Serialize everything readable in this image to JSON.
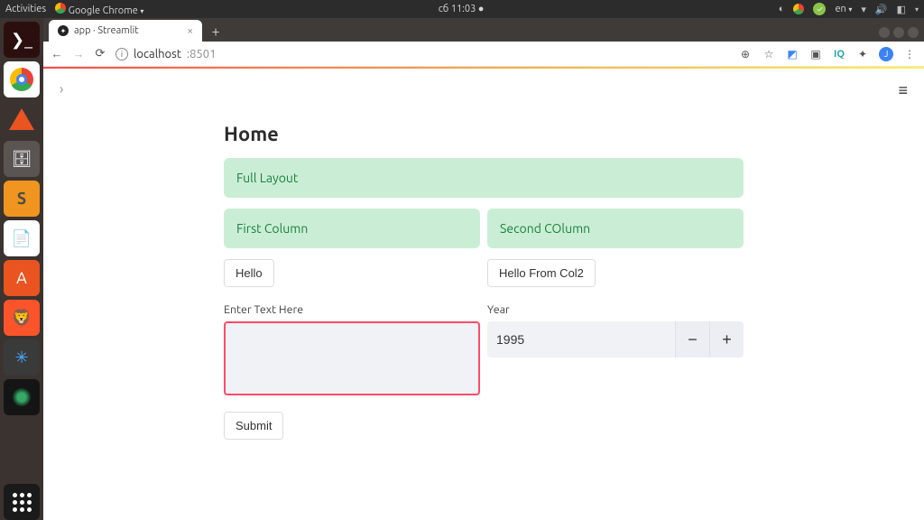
{
  "ubuntu": {
    "activities": "Activities",
    "active_app": "Google Chrome",
    "clock": "сб 11:03",
    "lang": "en"
  },
  "chrome": {
    "tab_title": "app · Streamlit",
    "url_host": "localhost",
    "url_port": ":8501"
  },
  "page": {
    "title": "Home",
    "full_layout_msg": "Full Layout",
    "col1": {
      "success": "First Column",
      "button": "Hello",
      "textarea_label": "Enter Text Here",
      "textarea_value": ""
    },
    "col2": {
      "success": "Second COlumn",
      "button": "Hello From Col2",
      "year_label": "Year",
      "year_value": "1995"
    },
    "submit": "Submit"
  }
}
